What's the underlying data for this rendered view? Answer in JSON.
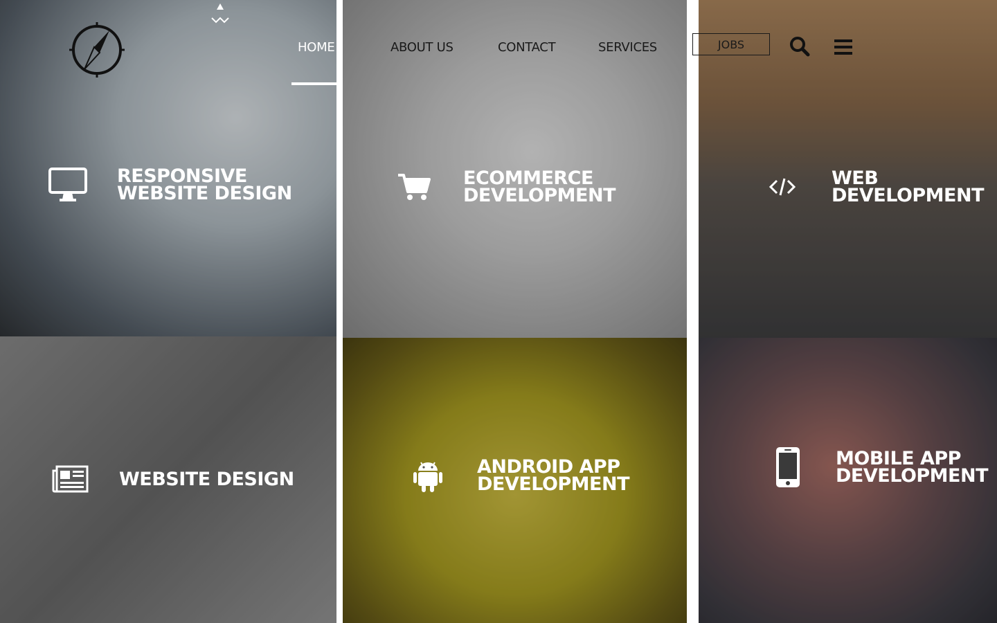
{
  "header": {
    "nav": [
      {
        "label": "HOME",
        "active": true
      },
      {
        "label": "ABOUT US",
        "active": false
      },
      {
        "label": "CONTACT",
        "active": false
      },
      {
        "label": "SERVICES",
        "active": false
      }
    ],
    "jobs_label": "JOBS",
    "icons": {
      "logo": "compass-logo-icon",
      "search": "search-icon",
      "menu": "hamburger-menu-icon"
    }
  },
  "services": [
    {
      "line1": "RESPONSIVE",
      "line2": "WEBSITE DESIGN",
      "icon": "desktop-monitor-icon"
    },
    {
      "line1": "ECOMMERCE",
      "line2": "DEVELOPMENT",
      "icon": "shopping-cart-icon"
    },
    {
      "line1": "WEB",
      "line2": "DEVELOPMENT",
      "icon": "code-brackets-icon"
    },
    {
      "line1": "WEBSITE DESIGN",
      "line2": "",
      "icon": "newspaper-icon"
    },
    {
      "line1": "ANDROID APP",
      "line2": "DEVELOPMENT",
      "icon": "android-icon"
    },
    {
      "line1": "MOBILE APP",
      "line2": "DEVELOPMENT",
      "icon": "mobile-phone-icon"
    }
  ],
  "colors": {
    "divider": "#ffffff",
    "text": "#ffffff",
    "nav_text": "#1a1a1a"
  }
}
